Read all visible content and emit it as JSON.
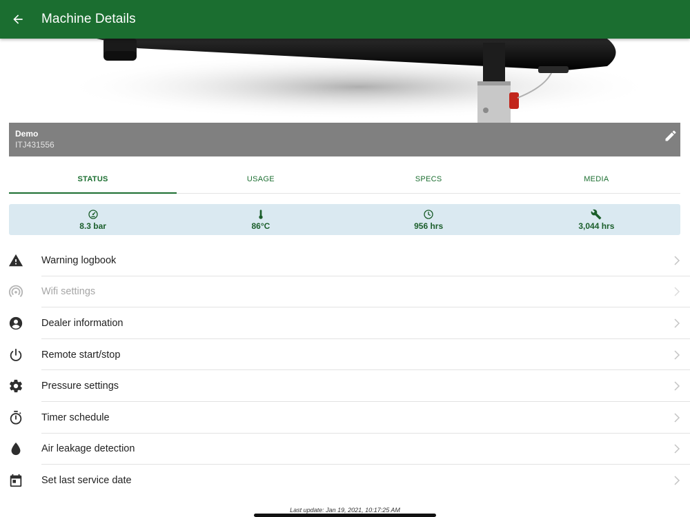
{
  "appbar": {
    "title": "Machine Details"
  },
  "machine": {
    "name": "Demo",
    "serial": "ITJ431556"
  },
  "tabs": [
    {
      "label": "STATUS",
      "active": true
    },
    {
      "label": "USAGE",
      "active": false
    },
    {
      "label": "SPECS",
      "active": false
    },
    {
      "label": "MEDIA",
      "active": false
    }
  ],
  "stats": [
    {
      "icon": "gauge-icon",
      "value": "8.3 bar"
    },
    {
      "icon": "thermometer-icon",
      "value": "86°C"
    },
    {
      "icon": "clock-icon",
      "value": "956 hrs"
    },
    {
      "icon": "wrench-icon",
      "value": "3,044 hrs"
    }
  ],
  "menu": [
    {
      "icon": "warning-icon",
      "label": "Warning logbook",
      "enabled": true
    },
    {
      "icon": "wifi-icon",
      "label": "Wifi settings",
      "enabled": false
    },
    {
      "icon": "account-icon",
      "label": "Dealer information",
      "enabled": true
    },
    {
      "icon": "power-icon",
      "label": "Remote start/stop",
      "enabled": true
    },
    {
      "icon": "gear-icon",
      "label": "Pressure settings",
      "enabled": true
    },
    {
      "icon": "timer-icon",
      "label": "Timer schedule",
      "enabled": true
    },
    {
      "icon": "drop-icon",
      "label": "Air leakage detection",
      "enabled": true
    },
    {
      "icon": "calendar-icon",
      "label": "Set last service date",
      "enabled": true
    }
  ],
  "footer": {
    "last_update": "Last update: Jan 19, 2021, 10:17:25 AM"
  },
  "colors": {
    "primary": "#1b6e30",
    "machine_bar": "#808080",
    "stats_bg": "#dae9f1"
  }
}
